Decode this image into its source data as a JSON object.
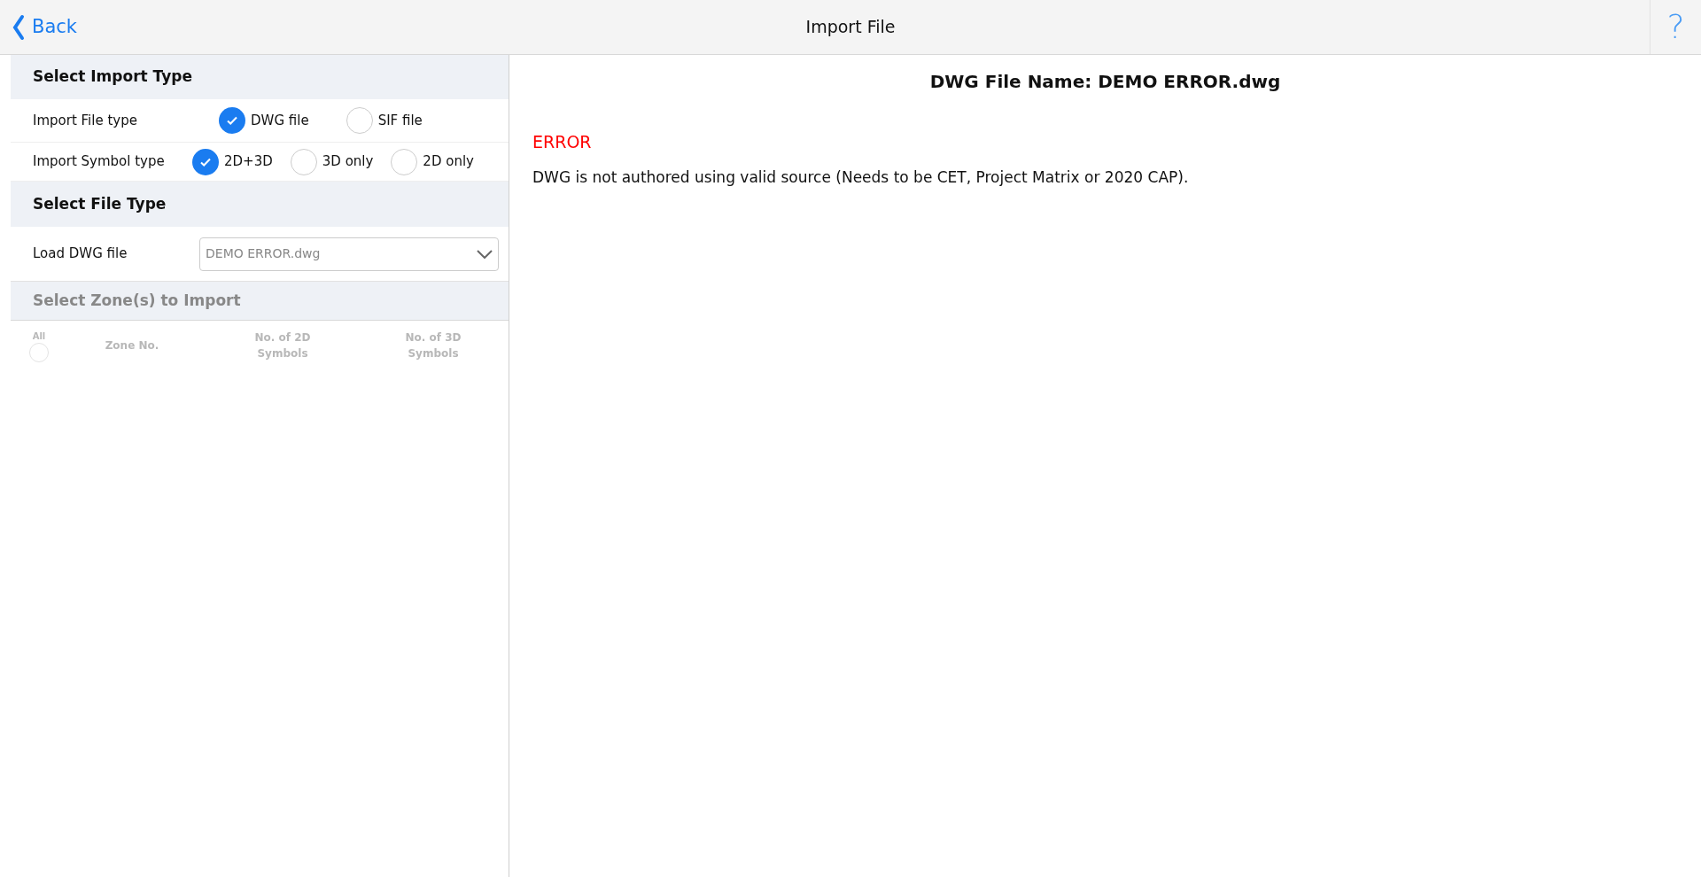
{
  "header": {
    "back_label": "Back",
    "title": "Import File",
    "help": "?"
  },
  "import_type": {
    "heading": "Select Import Type",
    "rows": [
      {
        "label": "Import File type",
        "options": [
          {
            "label": "DWG file",
            "selected": true
          },
          {
            "label": "SIF file",
            "selected": false
          }
        ]
      },
      {
        "label": "Import Symbol type",
        "options": [
          {
            "label": "2D+3D",
            "selected": true
          },
          {
            "label": "3D only",
            "selected": false
          },
          {
            "label": "2D only",
            "selected": false
          }
        ]
      }
    ]
  },
  "file_type": {
    "heading": "Select File Type",
    "label": "Load DWG file",
    "value": "DEMO ERROR.dwg"
  },
  "zones": {
    "heading": "Select Zone(s) to Import",
    "disabled": true,
    "all_label": "All",
    "all_checked": false,
    "columns": [
      "Zone No.",
      "No. of 2D Symbols",
      "No. of 3D Symbols"
    ]
  },
  "detail": {
    "title": "DWG File Name: DEMO ERROR.dwg",
    "error_label": "ERROR",
    "message": "DWG is not authored using valid source (Needs to be CET, Project Matrix or 2020 CAP)."
  }
}
